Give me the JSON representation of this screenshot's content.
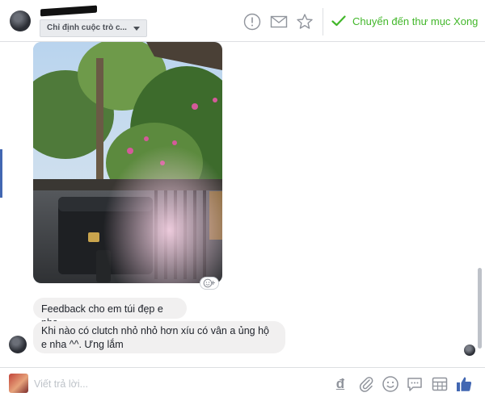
{
  "header": {
    "assign_dropdown": "Chỉ định cuộc trò c...",
    "done_button": "Chuyển đến thư mục Xong",
    "icons": [
      "alert-icon",
      "mail-icon",
      "star-icon",
      "checkmark-icon"
    ],
    "done_color": "#42b72a"
  },
  "thread": {
    "messages": [
      {
        "text": "Feedback cho em túi đẹp e nha"
      },
      {
        "text": "Khi nào có clutch nhỏ nhỏ hơn xíu có vân a ủng hộ e nha ^^. Ưng lắm"
      }
    ]
  },
  "composer": {
    "placeholder": "Viết trả lời...",
    "currency_symbol": "đ",
    "icons": [
      "currency-icon",
      "attachment-icon",
      "emoji-icon",
      "saved-reply-icon",
      "template-icon",
      "like-icon"
    ],
    "like_color": "#4267b2"
  }
}
